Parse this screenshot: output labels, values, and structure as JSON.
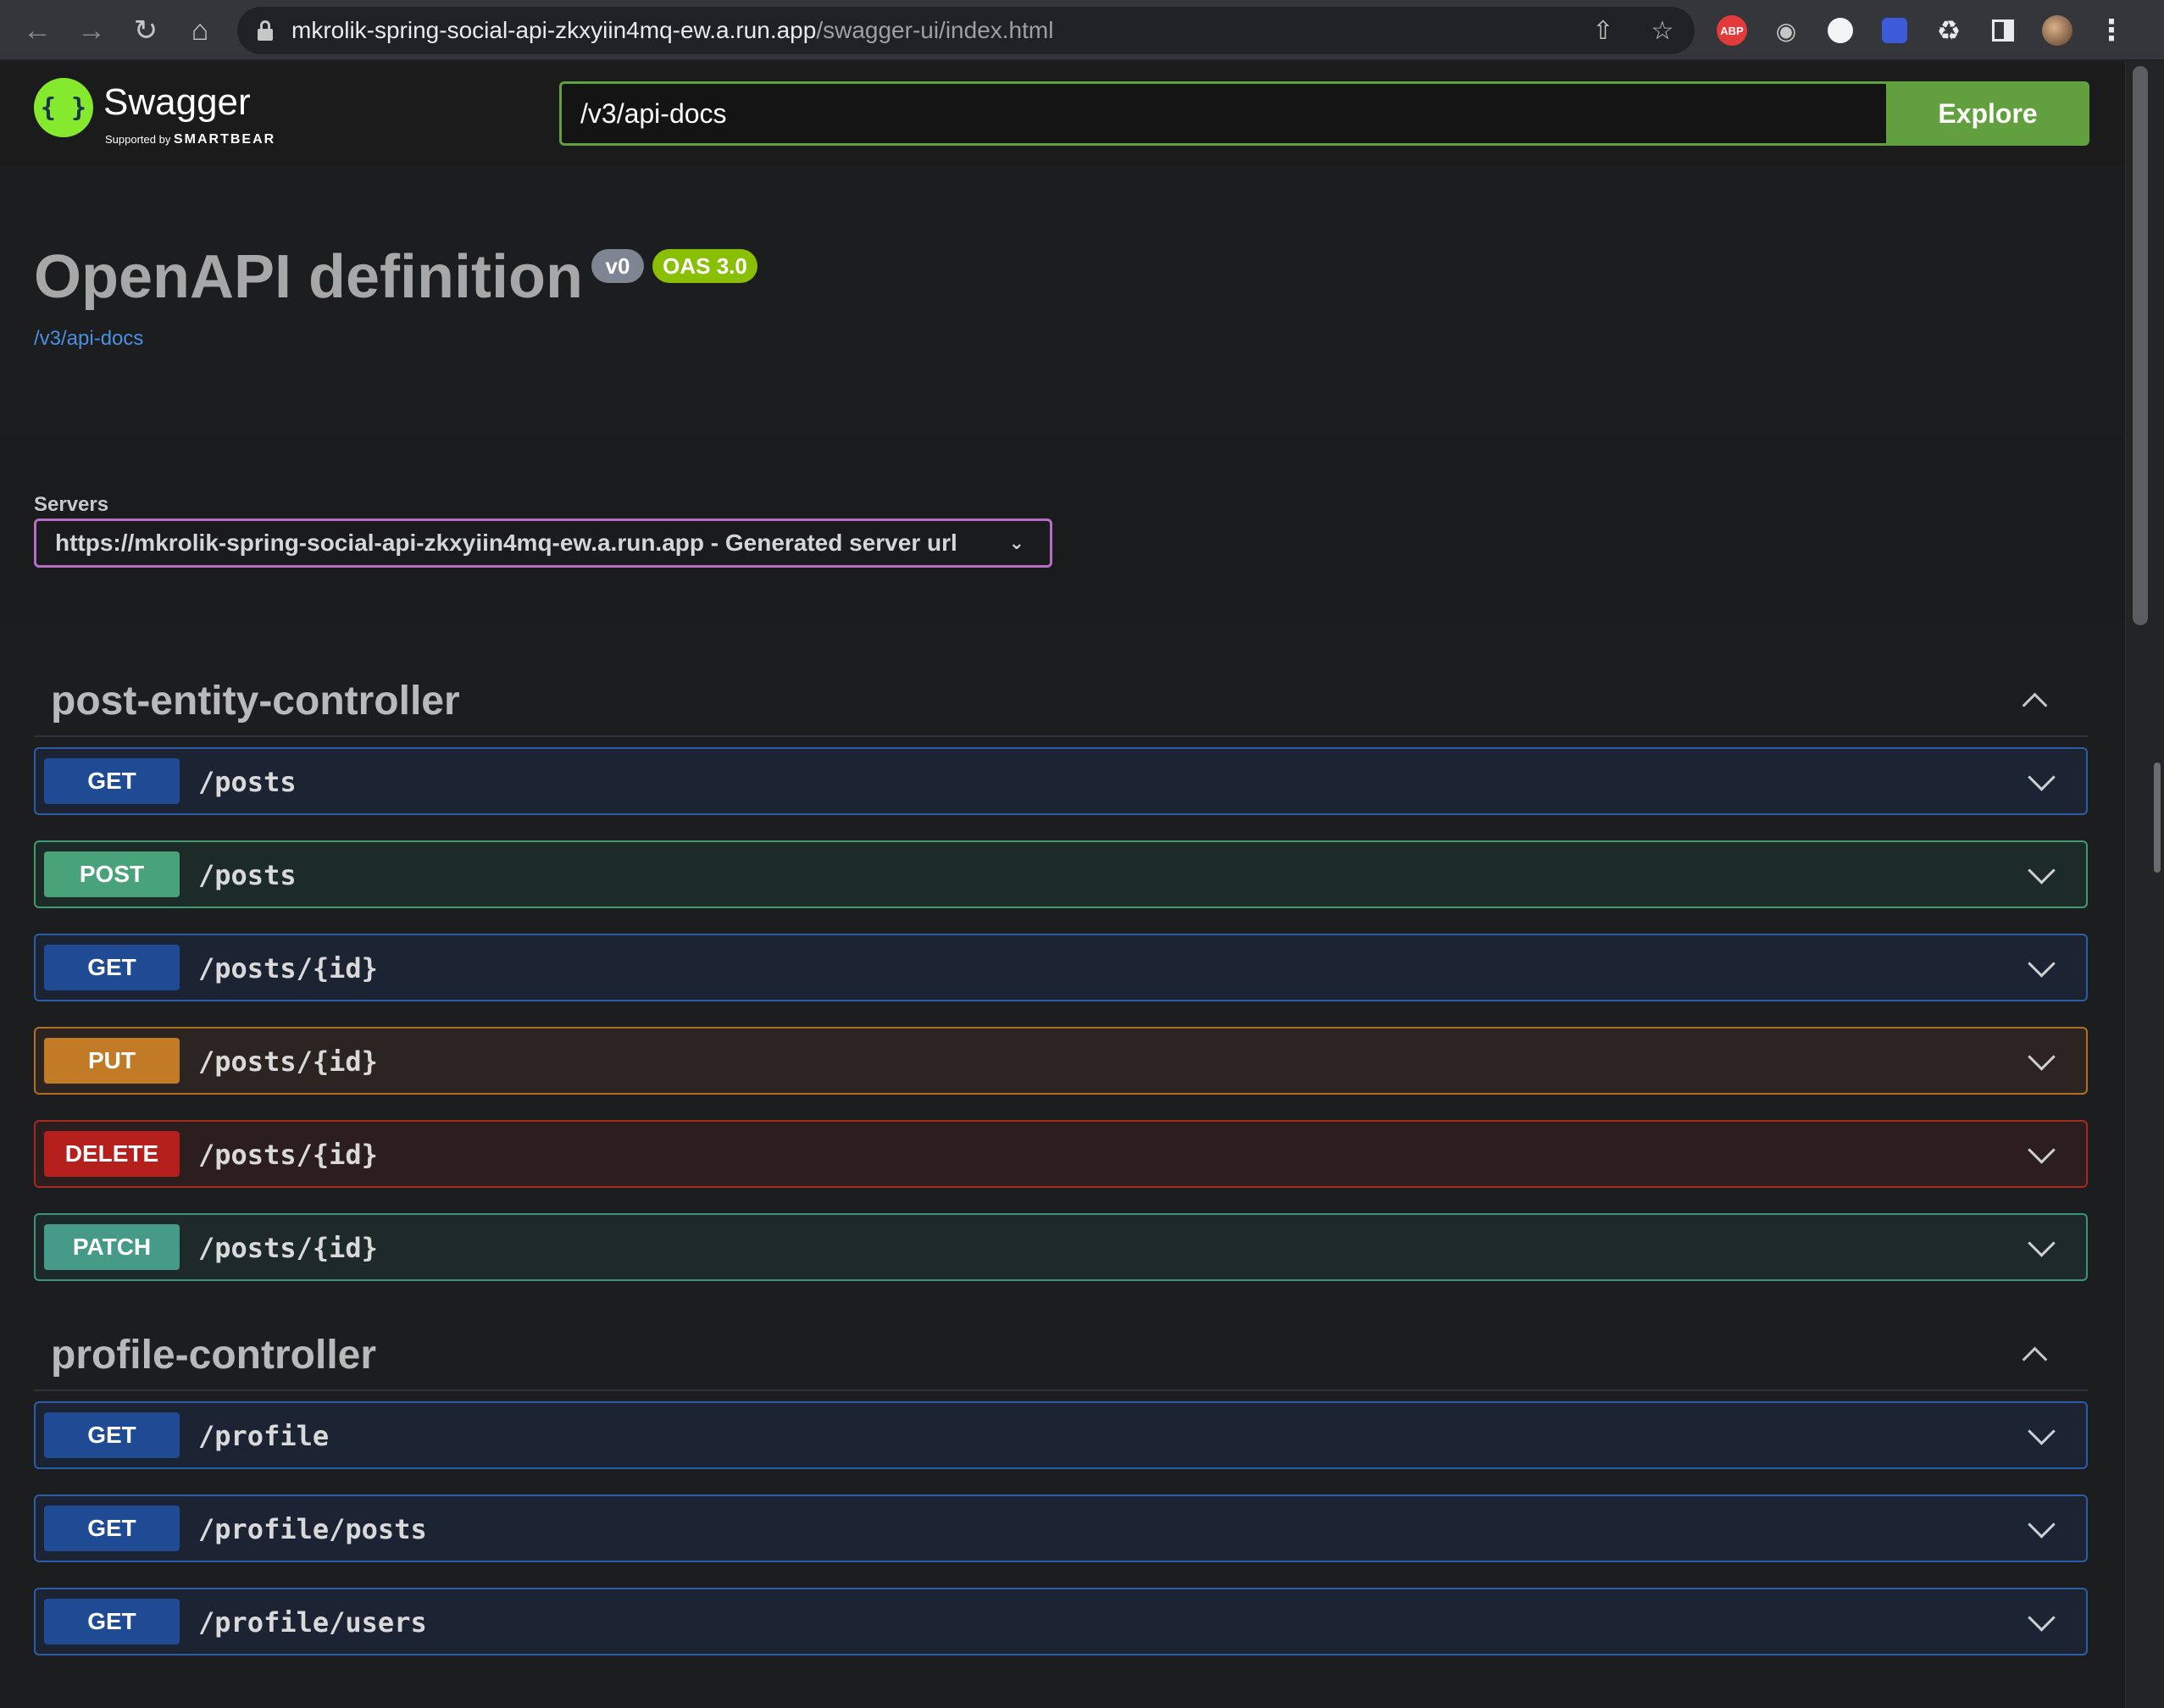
{
  "browser": {
    "url_host": "mkrolik-spring-social-api-zkxyiin4mq-ew.a.run.app",
    "url_path": "/swagger-ui/index.html",
    "extensions": [
      "ABP"
    ]
  },
  "topbar": {
    "logo_text": "Swagger",
    "logo_sub_prefix": "Supported by",
    "logo_sub_brand": "SMARTBEAR",
    "spec_url_value": "/v3/api-docs",
    "explore_label": "Explore"
  },
  "info": {
    "title": "OpenAPI definition",
    "version_badge": "v0",
    "oas_badge": "OAS 3.0",
    "spec_link": "/v3/api-docs"
  },
  "servers": {
    "label": "Servers",
    "selected": "https://mkrolik-spring-social-api-zkxyiin4mq-ew.a.run.app - Generated server url"
  },
  "tags": [
    {
      "name": "post-entity-controller",
      "operations": [
        {
          "method": "GET",
          "path": "/posts"
        },
        {
          "method": "POST",
          "path": "/posts"
        },
        {
          "method": "GET",
          "path": "/posts/{id}"
        },
        {
          "method": "PUT",
          "path": "/posts/{id}"
        },
        {
          "method": "DELETE",
          "path": "/posts/{id}"
        },
        {
          "method": "PATCH",
          "path": "/posts/{id}"
        }
      ]
    },
    {
      "name": "profile-controller",
      "operations": [
        {
          "method": "GET",
          "path": "/profile"
        },
        {
          "method": "GET",
          "path": "/profile/posts"
        },
        {
          "method": "GET",
          "path": "/profile/users"
        }
      ]
    }
  ],
  "colors": {
    "get": "#1f4a94",
    "post": "#49a37a",
    "put": "#c17a26",
    "delete": "#b51f1c",
    "patch": "#459b87",
    "explore": "#62a03f",
    "servers_border": "#b46fc5"
  },
  "icons": [
    "back-arrow-icon",
    "forward-arrow-icon",
    "reload-icon",
    "home-icon",
    "lock-icon",
    "share-icon",
    "star-icon",
    "puzzle-icon",
    "sidepanel-icon",
    "menu-dots-icon",
    "chevron-down-icon",
    "chevron-up-icon"
  ]
}
